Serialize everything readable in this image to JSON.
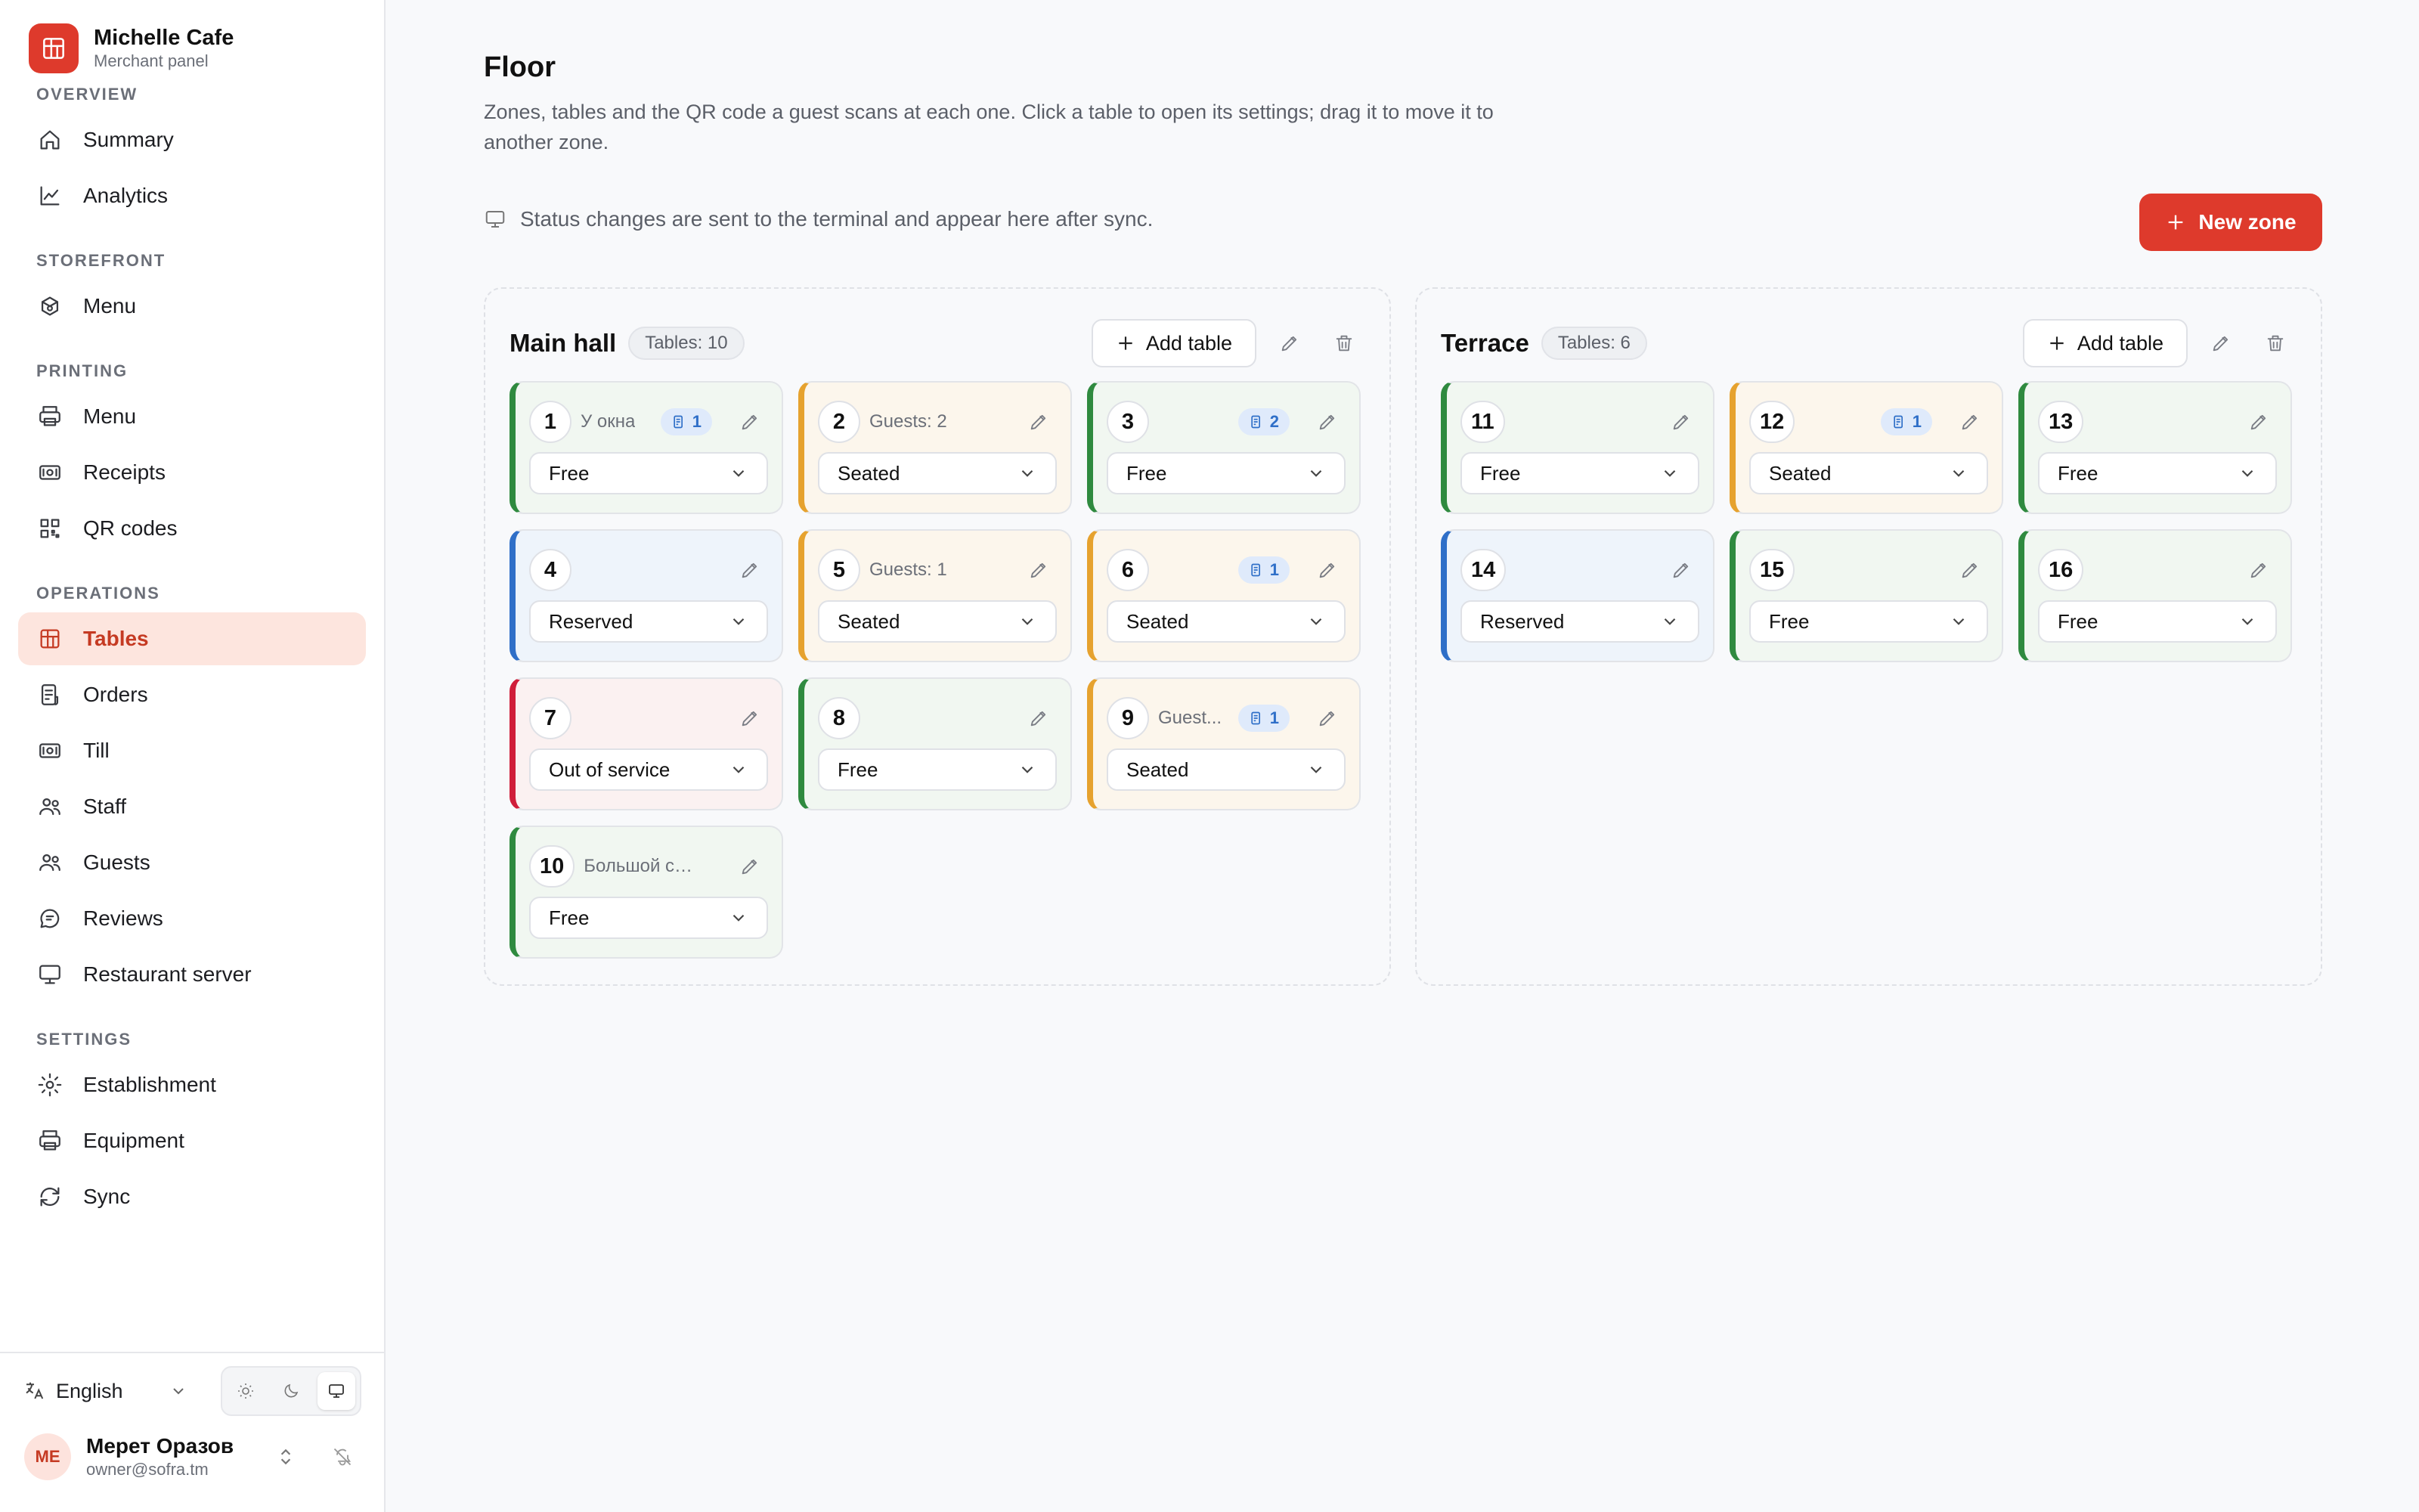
{
  "brand": {
    "name": "Michelle Cafe",
    "subtitle": "Merchant panel",
    "color": "#de3a2c"
  },
  "nav": {
    "sections": [
      {
        "title": "OVERVIEW",
        "items": [
          {
            "label": "Summary",
            "icon": "home-icon"
          },
          {
            "label": "Analytics",
            "icon": "chart-icon"
          }
        ]
      },
      {
        "title": "STOREFRONT",
        "items": [
          {
            "label": "Menu",
            "icon": "storefront-menu-icon"
          }
        ]
      },
      {
        "title": "PRINTING",
        "items": [
          {
            "label": "Menu",
            "icon": "printer-icon"
          },
          {
            "label": "Receipts",
            "icon": "receipt-icon"
          },
          {
            "label": "QR codes",
            "icon": "qr-icon"
          }
        ]
      },
      {
        "title": "OPERATIONS",
        "items": [
          {
            "label": "Tables",
            "icon": "grid-icon",
            "active": true
          },
          {
            "label": "Orders",
            "icon": "orders-icon"
          },
          {
            "label": "Till",
            "icon": "till-icon"
          },
          {
            "label": "Staff",
            "icon": "users-icon"
          },
          {
            "label": "Guests",
            "icon": "guests-icon"
          },
          {
            "label": "Reviews",
            "icon": "chat-icon"
          },
          {
            "label": "Restaurant server",
            "icon": "monitor-icon"
          }
        ]
      },
      {
        "title": "SETTINGS",
        "items": [
          {
            "label": "Establishment",
            "icon": "gear-icon"
          },
          {
            "label": "Equipment",
            "icon": "equipment-icon"
          },
          {
            "label": "Sync",
            "icon": "sync-icon"
          }
        ]
      }
    ]
  },
  "footer": {
    "language": "English",
    "user": {
      "initials": "МЕ",
      "name": "Мерет Оразов",
      "email": "owner@sofra.tm"
    }
  },
  "page": {
    "title": "Floor",
    "description": "Zones, tables and the QR code a guest scans at each one. Click a table to open its settings; drag it to move it to another zone.",
    "notice": "Status changes are sent to the terminal and appear here after sync.",
    "new_zone_label": "New zone"
  },
  "zones": [
    {
      "name": "Main hall",
      "badge": "Tables: 10",
      "add_label": "Add table",
      "tables": [
        {
          "num": "1",
          "label": "У окна",
          "badge": "1",
          "status": "Free",
          "kind": "free"
        },
        {
          "num": "2",
          "label": "Guests: 2",
          "badge": "",
          "status": "Seated",
          "kind": "seated"
        },
        {
          "num": "3",
          "label": "",
          "badge": "2",
          "status": "Free",
          "kind": "free"
        },
        {
          "num": "4",
          "label": "",
          "badge": "",
          "status": "Reserved",
          "kind": "reserved"
        },
        {
          "num": "5",
          "label": "Guests: 1",
          "badge": "",
          "status": "Seated",
          "kind": "seated"
        },
        {
          "num": "6",
          "label": "",
          "badge": "1",
          "status": "Seated",
          "kind": "seated"
        },
        {
          "num": "7",
          "label": "",
          "badge": "",
          "status": "Out of service",
          "kind": "oos"
        },
        {
          "num": "8",
          "label": "",
          "badge": "",
          "status": "Free",
          "kind": "free"
        },
        {
          "num": "9",
          "label": "Guest...",
          "badge": "1",
          "status": "Seated",
          "kind": "seated"
        },
        {
          "num": "10",
          "label": "Большой стол",
          "badge": "",
          "status": "Free",
          "kind": "free"
        }
      ]
    },
    {
      "name": "Terrace",
      "badge": "Tables: 6",
      "add_label": "Add table",
      "tables": [
        {
          "num": "11",
          "label": "",
          "badge": "",
          "status": "Free",
          "kind": "free"
        },
        {
          "num": "12",
          "label": "",
          "badge": "1",
          "status": "Seated",
          "kind": "seated"
        },
        {
          "num": "13",
          "label": "",
          "badge": "",
          "status": "Free",
          "kind": "free"
        },
        {
          "num": "14",
          "label": "",
          "badge": "",
          "status": "Reserved",
          "kind": "reserved"
        },
        {
          "num": "15",
          "label": "",
          "badge": "",
          "status": "Free",
          "kind": "free"
        },
        {
          "num": "16",
          "label": "",
          "badge": "",
          "status": "Free",
          "kind": "free"
        }
      ]
    }
  ],
  "colors": {
    "free": "#2f8a3f",
    "seated": "#e6a22e",
    "reserved": "#2f6fc8",
    "out_of_service": "#d01e3a",
    "accent": "#de3a2c"
  }
}
